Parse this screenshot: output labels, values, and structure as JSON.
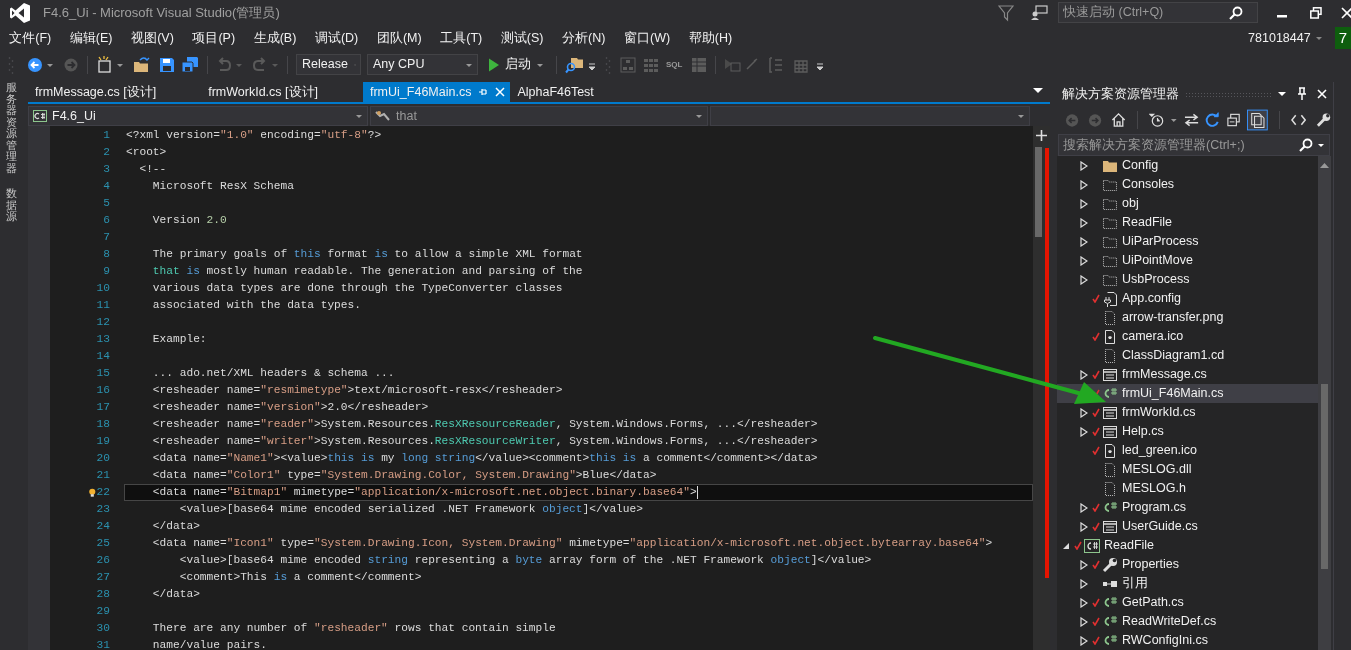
{
  "window": {
    "title": "F4.6_Ui - Microsoft Visual Studio(管理员)",
    "quick_launch": {
      "placeholder": "快速启动 (Ctrl+Q)"
    }
  },
  "menu": [
    "文件(F)",
    "编辑(E)",
    "视图(V)",
    "项目(P)",
    "生成(B)",
    "调试(D)",
    "团队(M)",
    "工具(T)",
    "测试(S)",
    "分析(N)",
    "窗口(W)",
    "帮助(H)"
  ],
  "account": {
    "user": "781018447",
    "badge": "7"
  },
  "toolbar": {
    "configuration": "Release",
    "platform": "Any CPU",
    "start": "启动",
    "sql": "SQL"
  },
  "side_tabs": [
    "服务器资源管理器",
    "数据源"
  ],
  "doc_tabs": [
    {
      "label": "frmMessage.cs [设计]",
      "selected": false
    },
    {
      "label": "frmWorkId.cs [设计]",
      "selected": false
    },
    {
      "label": "frmUi_F46Main.cs",
      "selected": true
    },
    {
      "label": "AlphaF46Test",
      "selected": false
    }
  ],
  "nav_bar": {
    "project": "F4.6_Ui",
    "member": "that"
  },
  "code": {
    "lines": [
      {
        "number": "1",
        "current": false,
        "lightbulb": false,
        "tokens": [
          {
            "kind": "text",
            "text": "<?xml version="
          },
          {
            "kind": "string",
            "text": "\"1.0\""
          },
          {
            "kind": "text",
            "text": " encoding="
          },
          {
            "kind": "string",
            "text": "\"utf-8\""
          },
          {
            "kind": "text",
            "text": "?>"
          }
        ]
      },
      {
        "number": "2",
        "current": false,
        "lightbulb": false,
        "tokens": [
          {
            "kind": "text",
            "text": "<root>"
          }
        ]
      },
      {
        "number": "3",
        "current": false,
        "lightbulb": false,
        "tokens": [
          {
            "kind": "text",
            "text": "  <!--"
          }
        ]
      },
      {
        "number": "4",
        "current": false,
        "lightbulb": false,
        "tokens": [
          {
            "kind": "text",
            "text": "    Microsoft ResX Schema"
          }
        ]
      },
      {
        "number": "5",
        "current": false,
        "lightbulb": false
      },
      {
        "number": "6",
        "current": false,
        "lightbulb": false,
        "tokens": [
          {
            "kind": "text",
            "text": "    Version "
          },
          {
            "kind": "number",
            "text": "2.0"
          }
        ]
      },
      {
        "number": "7",
        "current": false,
        "lightbulb": false
      },
      {
        "number": "8",
        "current": false,
        "lightbulb": false,
        "tokens": [
          {
            "kind": "text",
            "text": "    The primary goals of "
          },
          {
            "kind": "keyword",
            "text": "this"
          },
          {
            "kind": "text",
            "text": " format "
          },
          {
            "kind": "keyword",
            "text": "is"
          },
          {
            "kind": "text",
            "text": " to allow a simple XML format"
          }
        ]
      },
      {
        "number": "9",
        "current": false,
        "lightbulb": false,
        "tokens": [
          {
            "kind": "type",
            "text": "    that"
          },
          {
            "kind": "keyword",
            "text": " is"
          },
          {
            "kind": "text",
            "text": " mostly human readable. The generation and parsing of the"
          }
        ]
      },
      {
        "number": "10",
        "current": false,
        "lightbulb": false,
        "tokens": [
          {
            "kind": "text",
            "text": "    various data types are done through the TypeConverter classes"
          }
        ]
      },
      {
        "number": "11",
        "current": false,
        "lightbulb": false,
        "tokens": [
          {
            "kind": "text",
            "text": "    associated with the data types."
          }
        ]
      },
      {
        "number": "12",
        "current": false,
        "lightbulb": false
      },
      {
        "number": "13",
        "current": false,
        "lightbulb": false,
        "tokens": [
          {
            "kind": "text",
            "text": "    Example:"
          }
        ]
      },
      {
        "number": "14",
        "current": false,
        "lightbulb": false
      },
      {
        "number": "15",
        "current": false,
        "lightbulb": false,
        "tokens": [
          {
            "kind": "text",
            "text": "    ... ado.net/XML headers & schema ..."
          }
        ]
      },
      {
        "number": "16",
        "current": false,
        "lightbulb": false,
        "tokens": [
          {
            "kind": "text",
            "text": "    <resheader name="
          },
          {
            "kind": "string",
            "text": "\"resmimetype\""
          },
          {
            "kind": "text",
            "text": ">text/microsoft-resx</resheader>"
          }
        ]
      },
      {
        "number": "17",
        "current": false,
        "lightbulb": false,
        "tokens": [
          {
            "kind": "text",
            "text": "    <resheader name="
          },
          {
            "kind": "string",
            "text": "\"version\""
          },
          {
            "kind": "text",
            "text": ">2.0</resheader>"
          }
        ]
      },
      {
        "number": "18",
        "current": false,
        "lightbulb": false,
        "tokens": [
          {
            "kind": "text",
            "text": "    <resheader name="
          },
          {
            "kind": "string",
            "text": "\"reader\""
          },
          {
            "kind": "text",
            "text": ">System.Resources."
          },
          {
            "kind": "type",
            "text": "ResXResourceReader"
          },
          {
            "kind": "text",
            "text": ", System.Windows.Forms, ...</resheader>"
          }
        ]
      },
      {
        "number": "19",
        "current": false,
        "lightbulb": false,
        "tokens": [
          {
            "kind": "text",
            "text": "    <resheader name="
          },
          {
            "kind": "string",
            "text": "\"writer\""
          },
          {
            "kind": "text",
            "text": ">System.Resources."
          },
          {
            "kind": "type",
            "text": "ResXResourceWriter"
          },
          {
            "kind": "text",
            "text": ", System.Windows.Forms, ...</resheader>"
          }
        ]
      },
      {
        "number": "20",
        "current": false,
        "lightbulb": false,
        "tokens": [
          {
            "kind": "text",
            "text": "    <data name="
          },
          {
            "kind": "string",
            "text": "\"Name1\""
          },
          {
            "kind": "text",
            "text": "><value>"
          },
          {
            "kind": "keyword",
            "text": "this is"
          },
          {
            "kind": "text",
            "text": " my "
          },
          {
            "kind": "keyword",
            "text": "long string"
          },
          {
            "kind": "text",
            "text": "</value><comment>"
          },
          {
            "kind": "keyword",
            "text": "this is"
          },
          {
            "kind": "text",
            "text": " a comment</comment></data>"
          }
        ]
      },
      {
        "number": "21",
        "current": false,
        "lightbulb": false,
        "tokens": [
          {
            "kind": "text",
            "text": "    <data name="
          },
          {
            "kind": "string",
            "text": "\"Color1\""
          },
          {
            "kind": "text",
            "text": " type="
          },
          {
            "kind": "string",
            "text": "\"System.Drawing.Color, System.Drawing\""
          },
          {
            "kind": "text",
            "text": ">Blue</data>"
          }
        ]
      },
      {
        "number": "22",
        "current": true,
        "lightbulb": true,
        "tokens": [
          {
            "kind": "text",
            "text": "    <data name="
          },
          {
            "kind": "string",
            "text": "\"Bitmap1\""
          },
          {
            "kind": "text",
            "text": " mimetype="
          },
          {
            "kind": "string",
            "text": "\"application/x-microsoft.net.object.binary.base64\""
          },
          {
            "kind": "text",
            "text": ">"
          }
        ]
      },
      {
        "number": "23",
        "current": false,
        "lightbulb": false,
        "tokens": [
          {
            "kind": "text",
            "text": "        <value>[base64 mime encoded serialized .NET Framework "
          },
          {
            "kind": "keyword",
            "text": "object"
          },
          {
            "kind": "text",
            "text": "]</value>"
          }
        ]
      },
      {
        "number": "24",
        "current": false,
        "lightbulb": false,
        "tokens": [
          {
            "kind": "text",
            "text": "    </data>"
          }
        ]
      },
      {
        "number": "25",
        "current": false,
        "lightbulb": false,
        "tokens": [
          {
            "kind": "text",
            "text": "    <data name="
          },
          {
            "kind": "string",
            "text": "\"Icon1\""
          },
          {
            "kind": "text",
            "text": " type="
          },
          {
            "kind": "string",
            "text": "\"System.Drawing.Icon, System.Drawing\""
          },
          {
            "kind": "text",
            "text": " mimetype="
          },
          {
            "kind": "string",
            "text": "\"application/x-microsoft.net.object.bytearray.base64\""
          },
          {
            "kind": "text",
            "text": ">"
          }
        ]
      },
      {
        "number": "26",
        "current": false,
        "lightbulb": false,
        "tokens": [
          {
            "kind": "text",
            "text": "        <value>[base64 mime encoded "
          },
          {
            "kind": "keyword",
            "text": "string"
          },
          {
            "kind": "text",
            "text": " representing a "
          },
          {
            "kind": "keyword",
            "text": "byte"
          },
          {
            "kind": "text",
            "text": " array form of the .NET Framework "
          },
          {
            "kind": "keyword",
            "text": "object"
          },
          {
            "kind": "text",
            "text": "]</value>"
          }
        ]
      },
      {
        "number": "27",
        "current": false,
        "lightbulb": false,
        "tokens": [
          {
            "kind": "text",
            "text": "        <comment>This "
          },
          {
            "kind": "keyword",
            "text": "is"
          },
          {
            "kind": "text",
            "text": " a comment</comment>"
          }
        ]
      },
      {
        "number": "28",
        "current": false,
        "lightbulb": false,
        "tokens": [
          {
            "kind": "text",
            "text": "    </data>"
          }
        ]
      },
      {
        "number": "29",
        "current": false,
        "lightbulb": false
      },
      {
        "number": "30",
        "current": false,
        "lightbulb": false,
        "tokens": [
          {
            "kind": "text",
            "text": "    There are any number of "
          },
          {
            "kind": "string",
            "text": "\"resheader\""
          },
          {
            "kind": "text",
            "text": " rows that contain simple"
          }
        ]
      },
      {
        "number": "31",
        "current": false,
        "lightbulb": false,
        "tokens": [
          {
            "kind": "text",
            "text": "    name/value pairs."
          }
        ]
      }
    ]
  },
  "solution_explorer": {
    "title": "解决方案资源管理器",
    "search": {
      "placeholder": "搜索解决方案资源管理器(Ctrl+;)"
    },
    "tree": [
      {
        "children": [
          {
            "label": "Config",
            "kind": "folder",
            "expanded": false,
            "checked_in": false,
            "selected": false
          },
          {
            "label": "Consoles",
            "kind": "excluded-folder",
            "expanded": false,
            "checked_in": false,
            "selected": false
          },
          {
            "label": "obj",
            "kind": "excluded-folder",
            "expanded": false,
            "checked_in": false,
            "selected": false
          },
          {
            "label": "ReadFile",
            "kind": "excluded-folder",
            "expanded": false,
            "checked_in": false,
            "selected": false
          },
          {
            "label": "UiParProcess",
            "kind": "excluded-folder",
            "expanded": false,
            "checked_in": false,
            "selected": false
          },
          {
            "label": "UiPointMove",
            "kind": "excluded-folder",
            "expanded": false,
            "checked_in": false,
            "selected": false
          },
          {
            "label": "UsbProcess",
            "kind": "excluded-folder",
            "expanded": false,
            "checked_in": false,
            "selected": false
          },
          {
            "label": "App.config",
            "kind": "config",
            "checked_in": true,
            "selected": false
          },
          {
            "label": "arrow-transfer.png",
            "kind": "file",
            "checked_in": false,
            "selected": false
          },
          {
            "label": "camera.ico",
            "kind": "resource",
            "checked_in": true,
            "selected": false
          },
          {
            "label": "ClassDiagram1.cd",
            "kind": "file",
            "checked_in": false,
            "selected": false
          },
          {
            "label": "frmMessage.cs",
            "kind": "form",
            "expanded": false,
            "checked_in": true,
            "selected": false
          },
          {
            "label": "frmUi_F46Main.cs",
            "kind": "code",
            "checked_in": true,
            "selected": true
          },
          {
            "label": "frmWorkId.cs",
            "kind": "form",
            "expanded": false,
            "checked_in": true,
            "selected": false
          },
          {
            "label": "Help.cs",
            "kind": "form",
            "expanded": false,
            "checked_in": true,
            "selected": false
          },
          {
            "label": "led_green.ico",
            "kind": "resource",
            "checked_in": true,
            "selected": false
          },
          {
            "label": "MESLOG.dll",
            "kind": "file",
            "checked_in": false,
            "selected": false
          },
          {
            "label": "MESLOG.h",
            "kind": "file",
            "checked_in": false,
            "selected": false
          },
          {
            "label": "Program.cs",
            "kind": "code",
            "expanded": false,
            "checked_in": true,
            "selected": false
          },
          {
            "label": "UserGuide.cs",
            "kind": "form",
            "expanded": false,
            "checked_in": true,
            "selected": false
          }
        ]
      },
      {
        "label": "ReadFile",
        "kind": "project",
        "expanded": true,
        "checked_in": true,
        "selected": false,
        "children": [
          {
            "label": "Properties",
            "kind": "properties",
            "expanded": false,
            "checked_in": true,
            "selected": false
          },
          {
            "label": "引用",
            "kind": "references",
            "expanded": false,
            "checked_in": false,
            "selected": false
          },
          {
            "label": "GetPath.cs",
            "kind": "code",
            "expanded": false,
            "checked_in": true,
            "selected": false
          },
          {
            "label": "ReadWriteDef.cs",
            "kind": "code",
            "expanded": false,
            "checked_in": true,
            "selected": false
          },
          {
            "label": "RWConfigIni.cs",
            "kind": "code",
            "expanded": false,
            "checked_in": true,
            "selected": false
          }
        ]
      }
    ]
  }
}
